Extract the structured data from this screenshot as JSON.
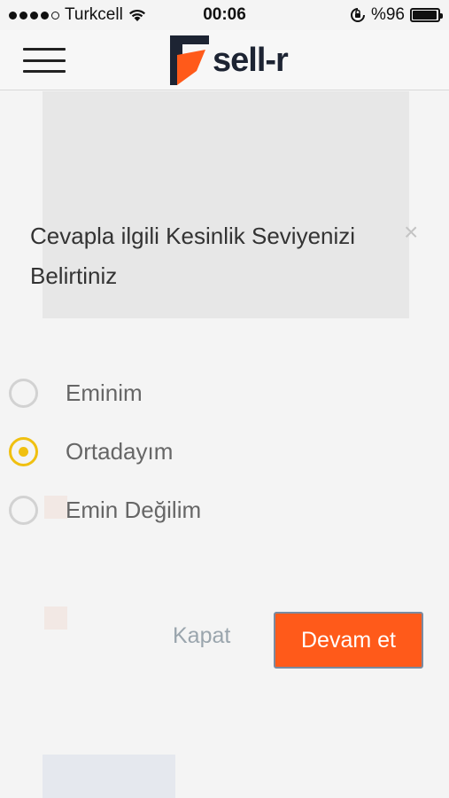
{
  "status_bar": {
    "carrier": "Turkcell",
    "time": "00:06",
    "battery": "%96",
    "battery_level": 0.96
  },
  "header": {
    "logo_text": "sell-r",
    "brand_color": "#ff5a1a",
    "brand_dark": "#1d2433"
  },
  "modal": {
    "title": "Cevapla ilgili Kesinlik Seviyenizi Belirtiniz",
    "options": [
      {
        "label": "Eminim",
        "selected": false
      },
      {
        "label": "Ortadayım",
        "selected": true
      },
      {
        "label": "Emin Değilim",
        "selected": false
      }
    ],
    "close_label": "Kapat",
    "continue_label": "Devam et",
    "selected_color": "#f0c010"
  }
}
